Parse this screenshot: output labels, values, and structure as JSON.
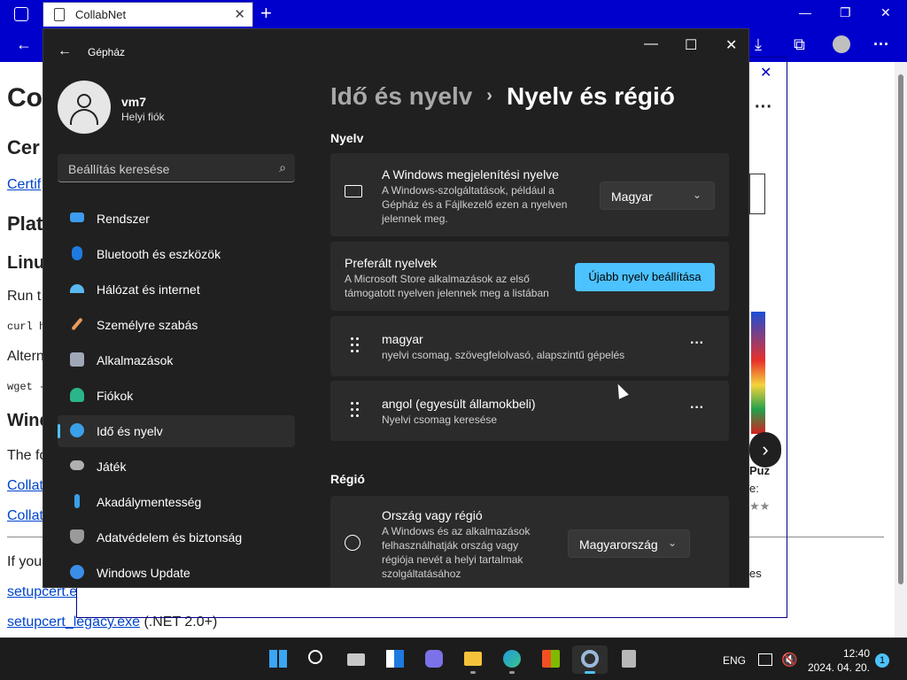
{
  "browser": {
    "tab_title": "CollabNet",
    "tab_close": "✕",
    "new_tab": "+",
    "min": "—",
    "max": "❐",
    "close": "✕",
    "toolbar": {
      "back": "←",
      "download": "⤓",
      "collections": "⧉",
      "more": "···"
    }
  },
  "page": {
    "h1": "Co",
    "h2_a": "Cer",
    "link_cert": "Certif",
    "h2_plat": "Plat",
    "h3_linux": "Linu",
    "run_text": "Run t",
    "code_curl": "curl h",
    "alt_text": "Altern",
    "code_wget": "wget -",
    "h3_win": "Wind",
    "follow_text": "The fo",
    "link_collab1": "Collat",
    "link_collab2": "Collat",
    "if_text": "If you",
    "link_setup": "setupcert.e",
    "link_legacy": "setupcert_legacy.exe",
    "legacy_suffix": " (.NET 2.0+)"
  },
  "store": {
    "close": "✕",
    "more": "···",
    "next": "›",
    "text_puz": "Puz",
    "text_e": "e: ",
    "text_stars": "★★",
    "text_es": "es"
  },
  "settings": {
    "app_title": "Gépház",
    "back": "←",
    "min": "—",
    "max": "☐",
    "close": "✕",
    "user": {
      "name": "vm7",
      "type": "Helyi fiók"
    },
    "search_placeholder": "Beállítás keresése",
    "search_icon": "⌕",
    "nav": [
      {
        "label": "Rendszer",
        "icon": "monitor-icon",
        "color": "#3b9cf0"
      },
      {
        "label": "Bluetooth és eszközök",
        "icon": "bluetooth-icon",
        "color": "#1f7ae0"
      },
      {
        "label": "Hálózat és internet",
        "icon": "wifi-icon",
        "color": "#5ab8f0"
      },
      {
        "label": "Személyre szabás",
        "icon": "brush-icon",
        "color": "#e89a5a"
      },
      {
        "label": "Alkalmazások",
        "icon": "apps-icon",
        "color": "#a0a8b8"
      },
      {
        "label": "Fiókok",
        "icon": "person-icon",
        "color": "#2bb58a"
      },
      {
        "label": "Idő és nyelv",
        "icon": "globe-clock-icon",
        "color": "#3aa0e8"
      },
      {
        "label": "Játék",
        "icon": "gamepad-icon",
        "color": "#b0b0b0"
      },
      {
        "label": "Akadálymentesség",
        "icon": "accessibility-icon",
        "color": "#3aa0e8"
      },
      {
        "label": "Adatvédelem és biztonság",
        "icon": "shield-icon",
        "color": "#9a9a9a"
      },
      {
        "label": "Windows Update",
        "icon": "update-icon",
        "color": "#3a8ee8"
      }
    ],
    "breadcrumb": {
      "parent": "Idő és nyelv",
      "sep": "›",
      "current": "Nyelv és régió"
    },
    "language": {
      "section": "Nyelv",
      "display": {
        "title": "A Windows megjelenítési nyelve",
        "desc": "A Windows-szolgáltatások, például a Gépház és a Fájlkezelő ezen a nyelven jelennek meg.",
        "value": "Magyar",
        "chevron": "⌄"
      },
      "preferred": {
        "title": "Preferált nyelvek",
        "desc": "A Microsoft Store alkalmazások az első támogatott nyelven jelennek meg a listában",
        "button": "Újabb nyelv beállítása"
      },
      "items": [
        {
          "name": "magyar",
          "detail": "nyelvi csomag, szövegfelolvasó, alapszintű gépelés",
          "more": "···"
        },
        {
          "name": "angol (egyesült államokbeli)",
          "detail": "Nyelvi csomag keresése",
          "more": "···"
        }
      ]
    },
    "region": {
      "section": "Régió",
      "country": {
        "title": "Ország vagy régió",
        "desc": "A Windows és az alkalmazások felhasználhatják ország vagy régiója nevét a helyi tartalmak szolgáltatásához",
        "value": "Magyarország",
        "chevron": "⌄"
      }
    }
  },
  "taskbar": {
    "lang": "ENG",
    "time": "12:40",
    "date": "2024. 04. 20.",
    "badge": "1",
    "apps": [
      "start",
      "search",
      "task-view",
      "widgets",
      "chat",
      "file-explorer",
      "edge",
      "store",
      "settings",
      "app"
    ]
  }
}
